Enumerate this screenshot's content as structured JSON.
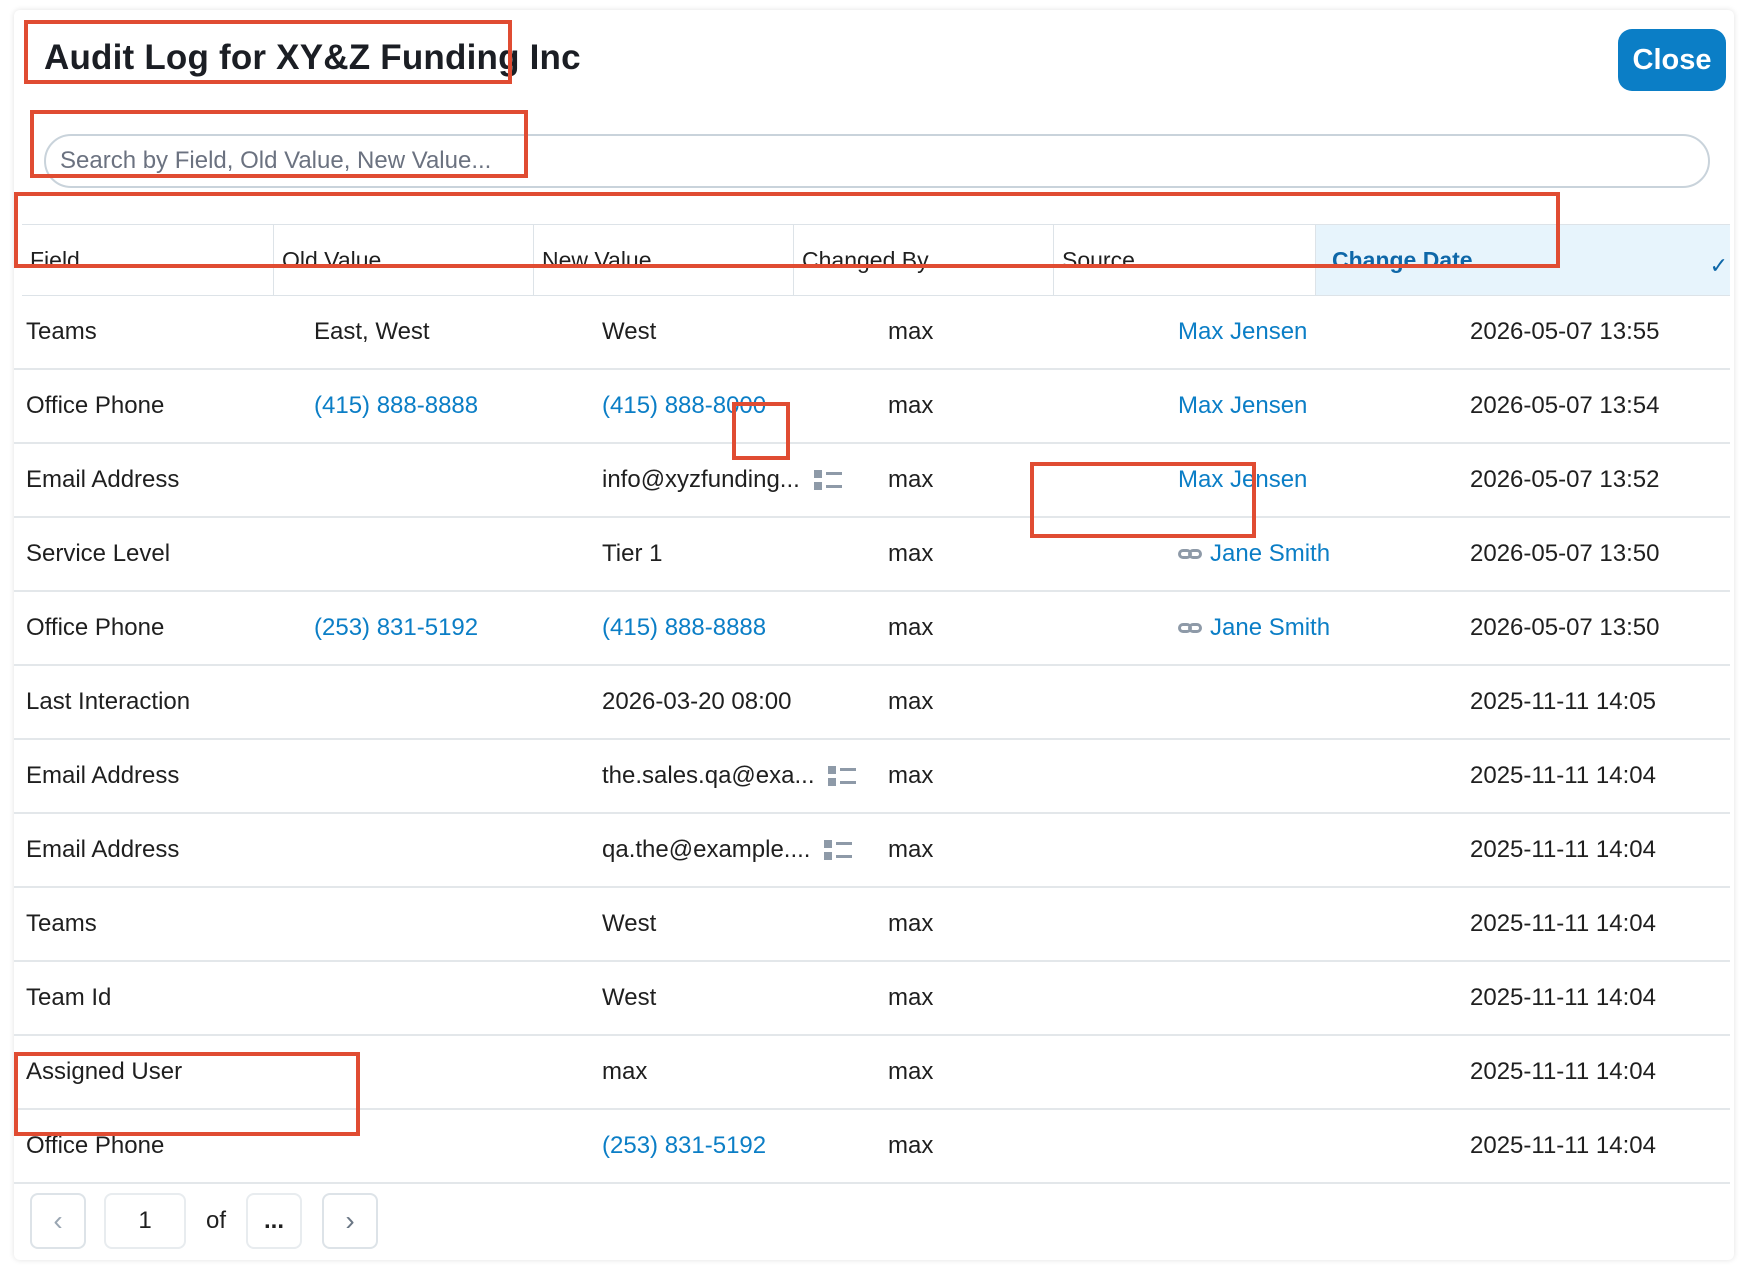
{
  "modal": {
    "title": "Audit Log for XY&Z Funding Inc",
    "close_label": "Close",
    "search_placeholder": "Search by Field, Old Value, New Value..."
  },
  "table": {
    "columns": [
      "Field",
      "Old Value",
      "New Value",
      "Changed By",
      "Source",
      "Change Date"
    ],
    "sorted_column": "Change Date",
    "sort_icon": "chevron-down-icon",
    "rows": [
      {
        "field": "Teams",
        "old": "East, West",
        "new": "West",
        "by": "max",
        "source": "Max Jensen",
        "date": "2026-05-07 13:55"
      },
      {
        "field": "Office Phone",
        "old": "(415) 888-8888",
        "new": "(415) 888-8000",
        "by": "max",
        "source": "Max Jensen",
        "date": "2026-05-07 13:54"
      },
      {
        "field": "Email Address",
        "old": "",
        "new": "info@xyzfunding...",
        "by": "max",
        "source": "Max Jensen",
        "date": "2026-05-07 13:52"
      },
      {
        "field": "Service Level",
        "old": "",
        "new": "Tier 1",
        "by": "max",
        "source": "Jane Smith",
        "date": "2026-05-07 13:50"
      },
      {
        "field": "Office Phone",
        "old": "(253) 831-5192",
        "new": "(415) 888-8888",
        "by": "max",
        "source": "Jane Smith",
        "date": "2026-05-07 13:50"
      },
      {
        "field": "Last Interaction",
        "old": "",
        "new": "2026-03-20 08:00",
        "by": "max",
        "source": "",
        "date": "2025-11-11 14:05"
      },
      {
        "field": "Email Address",
        "old": "",
        "new": "the.sales.qa@exa...",
        "by": "max",
        "source": "",
        "date": "2025-11-11 14:04"
      },
      {
        "field": "Email Address",
        "old": "",
        "new": "qa.the@example....",
        "by": "max",
        "source": "",
        "date": "2025-11-11 14:04"
      },
      {
        "field": "Teams",
        "old": "",
        "new": "West",
        "by": "max",
        "source": "",
        "date": "2025-11-11 14:04"
      },
      {
        "field": "Team Id",
        "old": "",
        "new": "West",
        "by": "max",
        "source": "",
        "date": "2025-11-11 14:04"
      },
      {
        "field": "Assigned User",
        "old": "",
        "new": "max",
        "by": "max",
        "source": "",
        "date": "2025-11-11 14:04"
      },
      {
        "field": "Office Phone",
        "old": "",
        "new": "(253) 831-5192",
        "by": "max",
        "source": "",
        "date": "2025-11-11 14:04"
      }
    ]
  },
  "pagination": {
    "prev_icon": "chevron-left-icon",
    "current_page": "1",
    "of_label": "of",
    "total_label": "...",
    "next_icon": "chevron-right-icon"
  },
  "colors": {
    "accent": "#0b7ec6",
    "highlight": "#e04c32",
    "active_header_bg": "#e7f4fc"
  }
}
